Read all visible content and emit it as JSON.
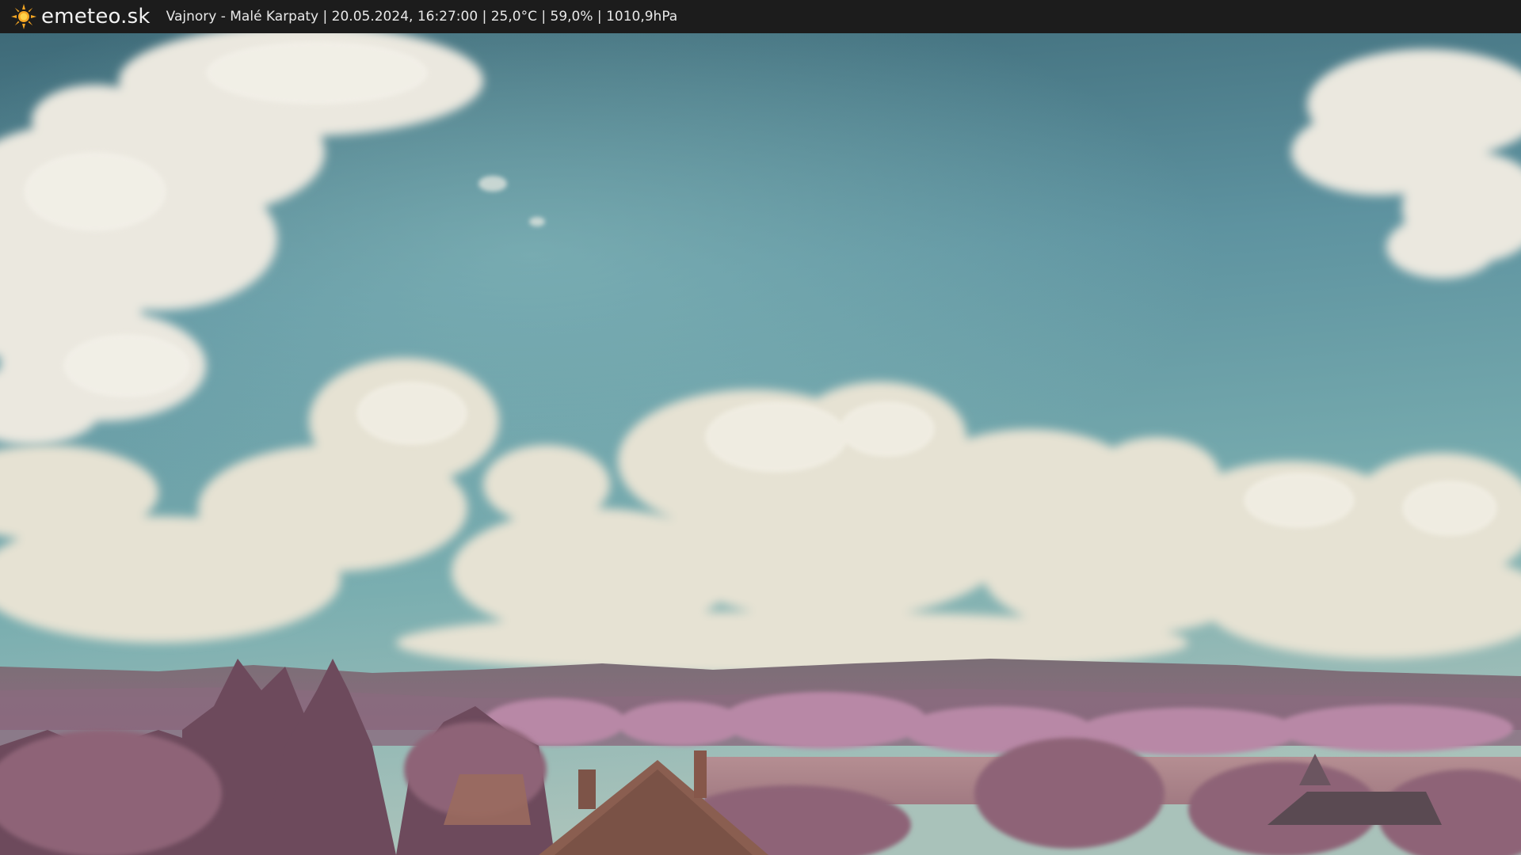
{
  "header": {
    "brand": "emeteo.sk",
    "logo_icon": "sun-icon",
    "location": "Vajnory - Malé Karpaty",
    "datetime": "20.05.2024, 16:27:00",
    "temperature": "25,0°C",
    "humidity": "59,0%",
    "pressure": "1010,9hPa",
    "separator": " | "
  },
  "colors": {
    "bar_bg": "#1c1c1c",
    "sun": "#f5a623",
    "sky_top": "#3f6f7c",
    "sky_mid": "#6aa2a8",
    "cloud": "#e9e7dc",
    "foliage": "#9b6f83"
  }
}
